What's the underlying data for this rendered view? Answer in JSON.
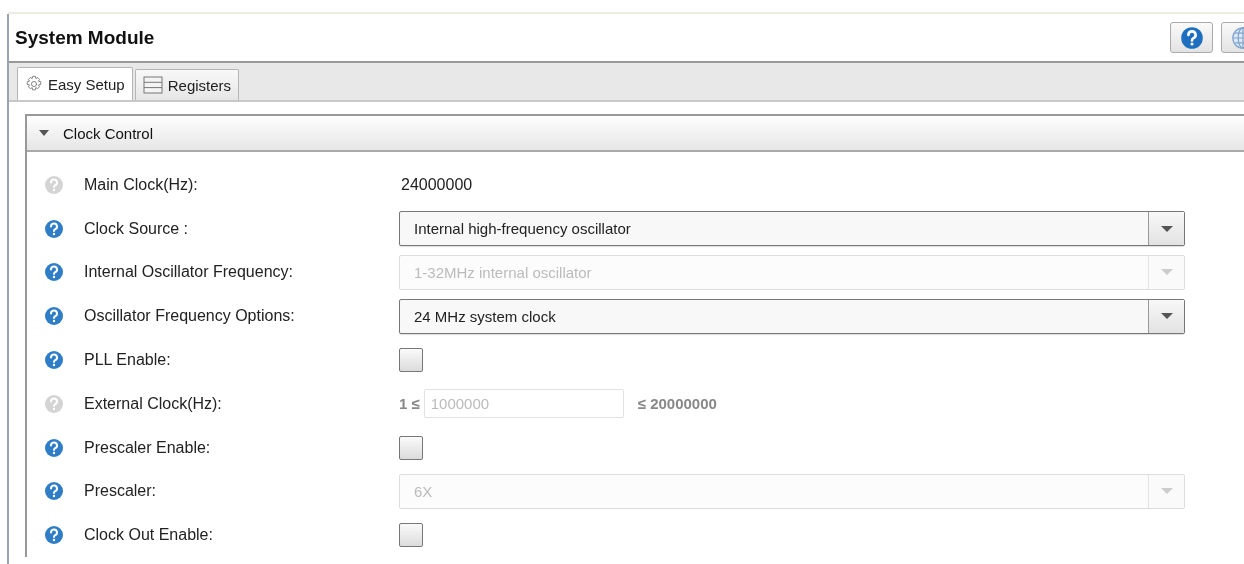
{
  "window": {
    "title": "System Module"
  },
  "toolbar_buttons": [
    {
      "kind": "help"
    },
    {
      "kind": "globe"
    }
  ],
  "tabs": [
    {
      "label": "Easy Setup",
      "kind": "gear",
      "selected": true
    },
    {
      "label": "Registers",
      "kind": "list",
      "selected": false
    }
  ],
  "section": {
    "title": "Clock Control",
    "expanded": true
  },
  "rows": [
    {
      "kind": "value",
      "label": "Main Clock(Hz):",
      "help_enabled": false,
      "value": "24000000"
    },
    {
      "kind": "dropdown",
      "label": "Clock Source :",
      "help_enabled": true,
      "value": "Internal high-frequency oscillator",
      "disabled": false
    },
    {
      "kind": "dropdown",
      "label": "Internal Oscillator Frequency:",
      "help_enabled": true,
      "value": "1-32MHz internal oscillator",
      "disabled": true
    },
    {
      "kind": "dropdown",
      "label": "Oscillator Frequency Options:",
      "help_enabled": true,
      "value": "24 MHz system clock",
      "disabled": false
    },
    {
      "kind": "checkbox",
      "label": "PLL Enable:",
      "help_enabled": true,
      "checked": false
    },
    {
      "kind": "range",
      "label": "External Clock(Hz):",
      "help_enabled": false,
      "min": "1 ≤",
      "value": "1000000",
      "max": "≤ 20000000",
      "disabled": true
    },
    {
      "kind": "checkbox",
      "label": "Prescaler Enable:",
      "help_enabled": true,
      "checked": false
    },
    {
      "kind": "dropdown",
      "label": "Prescaler:",
      "help_enabled": true,
      "value": "6X",
      "disabled": true
    },
    {
      "kind": "checkbox",
      "label": "Clock Out Enable:",
      "help_enabled": true,
      "checked": false
    }
  ]
}
